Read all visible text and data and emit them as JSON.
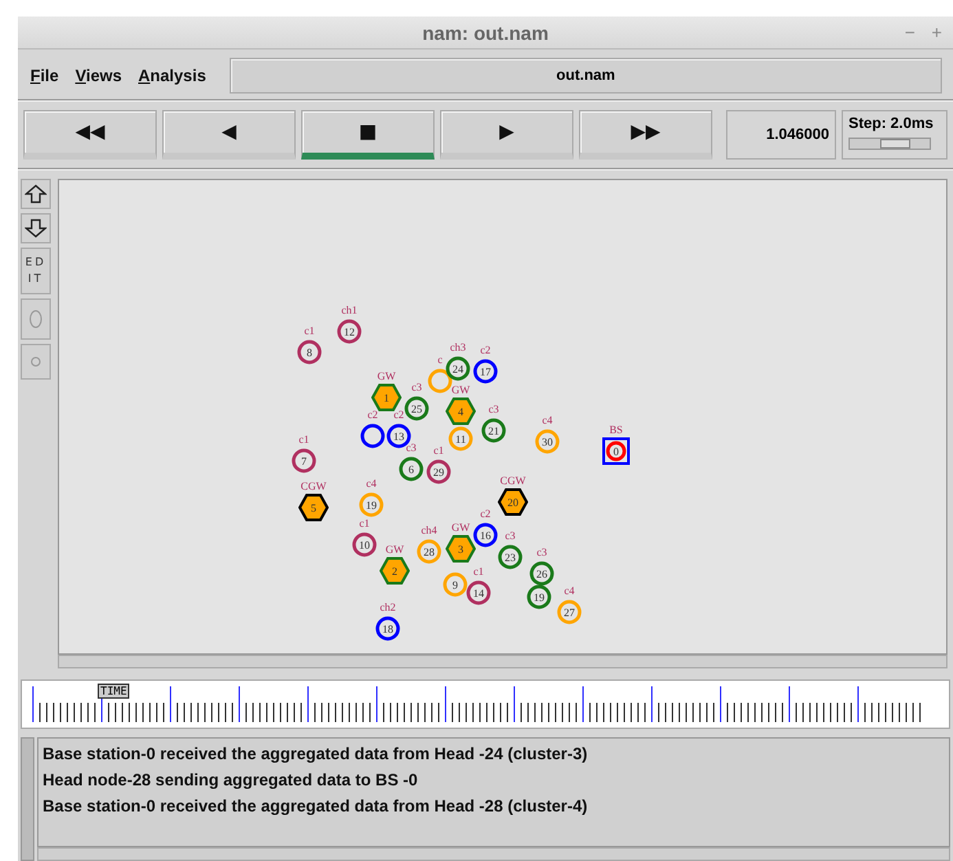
{
  "window": {
    "title": "nam: out.nam",
    "controls": [
      "−",
      "+"
    ]
  },
  "menu": [
    {
      "label": "File"
    },
    {
      "label": "Views"
    },
    {
      "label": "Analysis"
    }
  ],
  "file_name": "out.nam",
  "playback": [
    {
      "symbol": "◀◀",
      "selected": false
    },
    {
      "symbol": "◀",
      "selected": false
    },
    {
      "symbol": "■",
      "selected": true
    },
    {
      "symbol": "▶",
      "selected": false
    },
    {
      "symbol": "▶▶",
      "selected": false
    }
  ],
  "time": "1.046000",
  "step": {
    "label": "Step: 2.0ms",
    "level": 0.6
  },
  "side_tools": [
    {
      "kind": "zoom-in"
    },
    {
      "kind": "zoom-out"
    },
    {
      "kind": "edit",
      "label": "ED IT"
    },
    {
      "kind": "big-circle"
    },
    {
      "kind": "small-circle"
    }
  ],
  "nodes": [
    {
      "label": "ch1",
      "number": "12",
      "kind": "circle",
      "color": "#b03060"
    },
    {
      "label": "c1",
      "number": "8",
      "kind": "circle",
      "color": "#b03060"
    },
    {
      "label": "c",
      "kind": "circle",
      "color": "#ffa500"
    },
    {
      "label": "ch3",
      "number": "24",
      "kind": "circle",
      "color": "#1a7a1a"
    },
    {
      "label": "c2",
      "number": "17",
      "kind": "circle",
      "color": "#0000ff"
    },
    {
      "label": "GW",
      "number": "1",
      "kind": "hexagon",
      "color": "#1a7a1a"
    },
    {
      "label": "c3",
      "number": "25",
      "kind": "circle",
      "color": "#1a7a1a"
    },
    {
      "label": "GW",
      "number": "4",
      "kind": "hexagon",
      "color": "#1a7a1a"
    },
    {
      "label": "c2",
      "kind": "circle",
      "color": "#0000ff"
    },
    {
      "label": "c2",
      "number": "13",
      "kind": "circle",
      "color": "#0000ff"
    },
    {
      "label": "c3",
      "number": "21",
      "kind": "circle",
      "color": "#1a7a1a"
    },
    {
      "number": "11",
      "kind": "circle",
      "color": "#ffa500"
    },
    {
      "label": "c4",
      "number": "30",
      "kind": "circle",
      "color": "#ffa500"
    },
    {
      "label": "BS",
      "number": "0",
      "kind": "square",
      "color": "#ff0000"
    },
    {
      "label": "c1",
      "number": "7",
      "kind": "circle",
      "color": "#b03060"
    },
    {
      "label": "c3",
      "number": "6",
      "kind": "circle",
      "color": "#1a7a1a"
    },
    {
      "label": "c1",
      "number": "29",
      "kind": "circle",
      "color": "#b03060"
    },
    {
      "label": "CGW",
      "number": "5",
      "kind": "hexagon",
      "color": "#000000"
    },
    {
      "label": "c4",
      "number": "19",
      "kind": "circle",
      "color": "#ffa500"
    },
    {
      "label": "CGW",
      "number": "20",
      "kind": "hexagon",
      "color": "#000000"
    },
    {
      "label": "c1",
      "number": "10",
      "kind": "circle",
      "color": "#b03060"
    },
    {
      "label": "c2",
      "number": "16",
      "kind": "circle",
      "color": "#0000ff"
    },
    {
      "label": "ch4",
      "number": "28",
      "kind": "circle",
      "color": "#ffa500"
    },
    {
      "label": "GW",
      "number": "3",
      "kind": "hexagon",
      "color": "#1a7a1a"
    },
    {
      "label": "c3",
      "number": "23",
      "kind": "circle",
      "color": "#1a7a1a"
    },
    {
      "label": "GW",
      "number": "2",
      "kind": "hexagon",
      "color": "#1a7a1a"
    },
    {
      "number": "9",
      "kind": "circle",
      "color": "#ffa500"
    },
    {
      "label": "c1",
      "number": "14",
      "kind": "circle",
      "color": "#b03060"
    },
    {
      "label": "c3",
      "number": "26",
      "kind": "circle",
      "color": "#1a7a1a"
    },
    {
      "number": "19",
      "kind": "circle",
      "color": "#1a7a1a"
    },
    {
      "label": "c4",
      "number": "27",
      "kind": "circle",
      "color": "#ffa500"
    },
    {
      "label": "ch2",
      "number": "18",
      "kind": "circle",
      "color": "#0000ff"
    }
  ],
  "timeline": {
    "marker": "TIME"
  },
  "log": [
    "Base station-0 received the aggregated data from Head -24 (cluster-3)",
    "Head node-28 sending aggregated data to BS -0",
    "Base station-0 received the aggregated data from Head -28 (cluster-4)"
  ]
}
